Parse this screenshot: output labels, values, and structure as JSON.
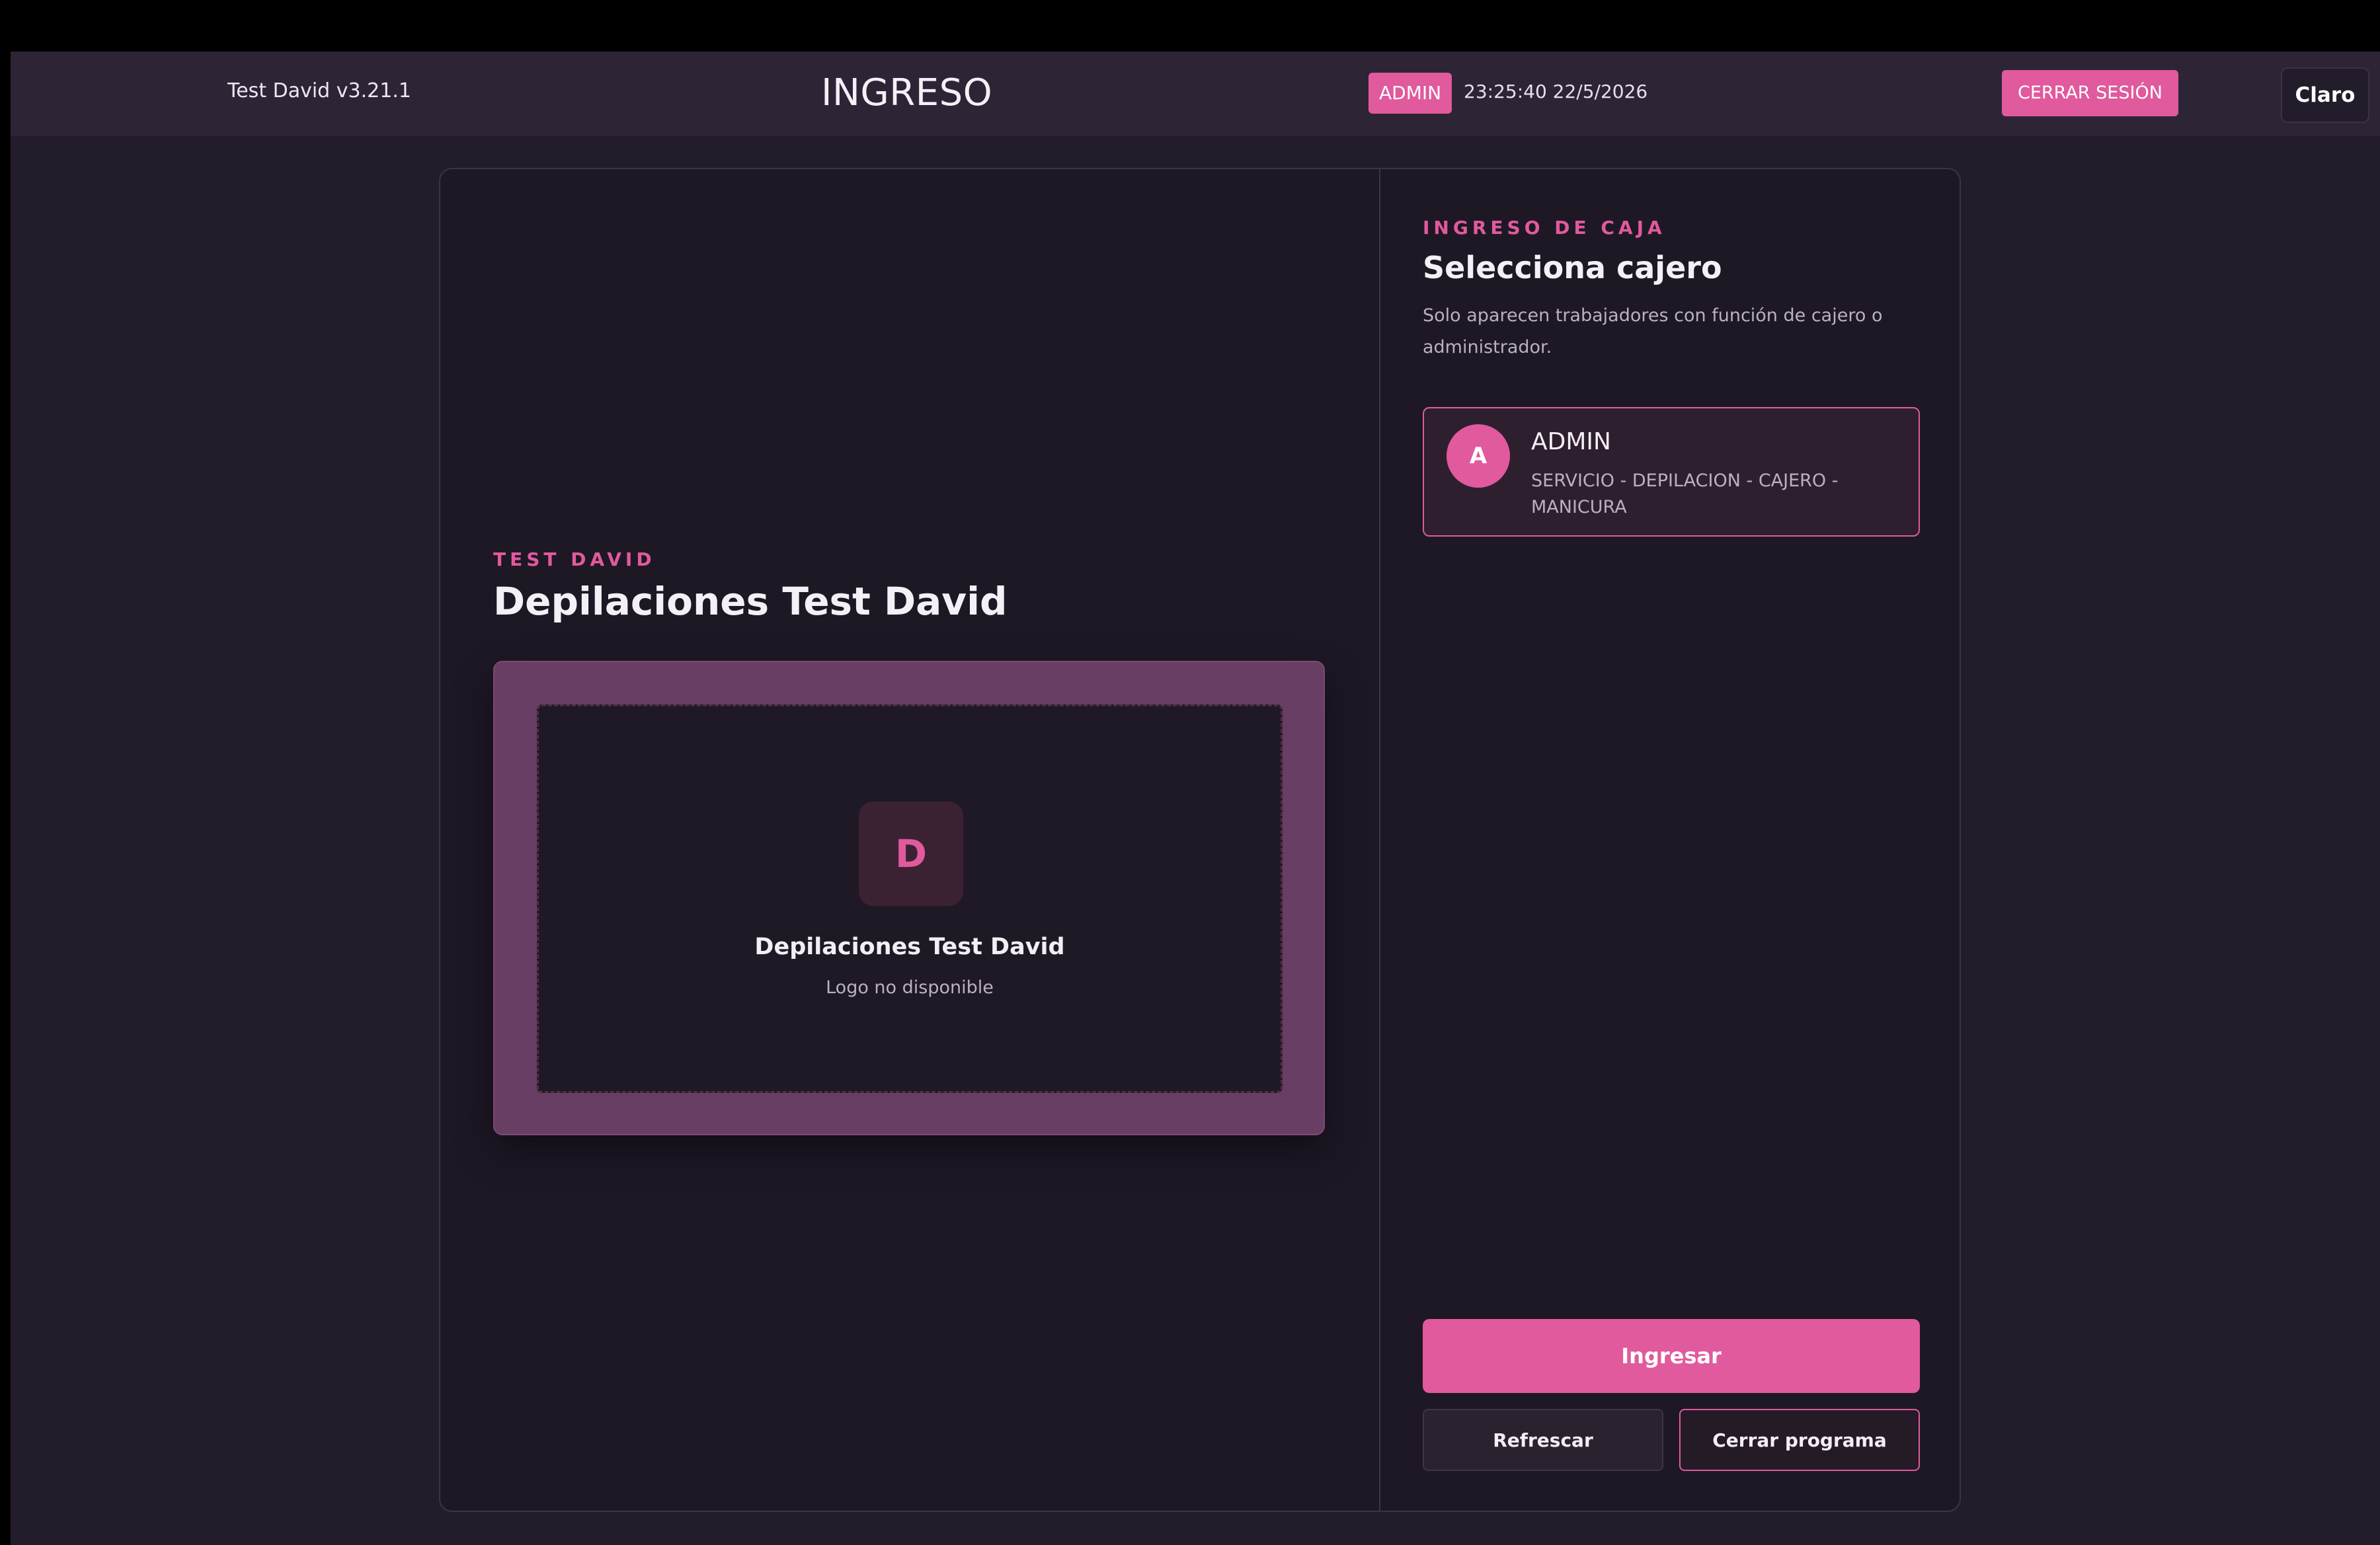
{
  "header": {
    "app_version": "Test David v3.21.1",
    "title": "INGRESO",
    "role_badge": "ADMIN",
    "datetime": "23:25:40 22/5/2026",
    "logout_label": "CERRAR SESIÓN",
    "theme_toggle_label": "Claro"
  },
  "business": {
    "eyebrow": "TEST DAVID",
    "name": "Depilaciones Test David",
    "logo": {
      "initial": "D",
      "caption": "Depilaciones Test David",
      "note": "Logo no disponible"
    }
  },
  "cashier_section": {
    "eyebrow": "INGRESO DE CAJA",
    "title": "Selecciona cajero",
    "description": "Solo aparecen trabajadores con función de cajero o administrador.",
    "cashiers": [
      {
        "initial": "A",
        "name": "ADMIN",
        "roles": "SERVICIO - DEPILACION - CAJERO - MANICURA",
        "selected": true
      }
    ]
  },
  "actions": {
    "enter_label": "Ingresar",
    "refresh_label": "Refrescar",
    "close_program_label": "Cerrar programa"
  },
  "colors": {
    "accent": "#e05a9d",
    "background": "#231d2b",
    "card": "#1e1825",
    "topbar": "#2d2536"
  }
}
